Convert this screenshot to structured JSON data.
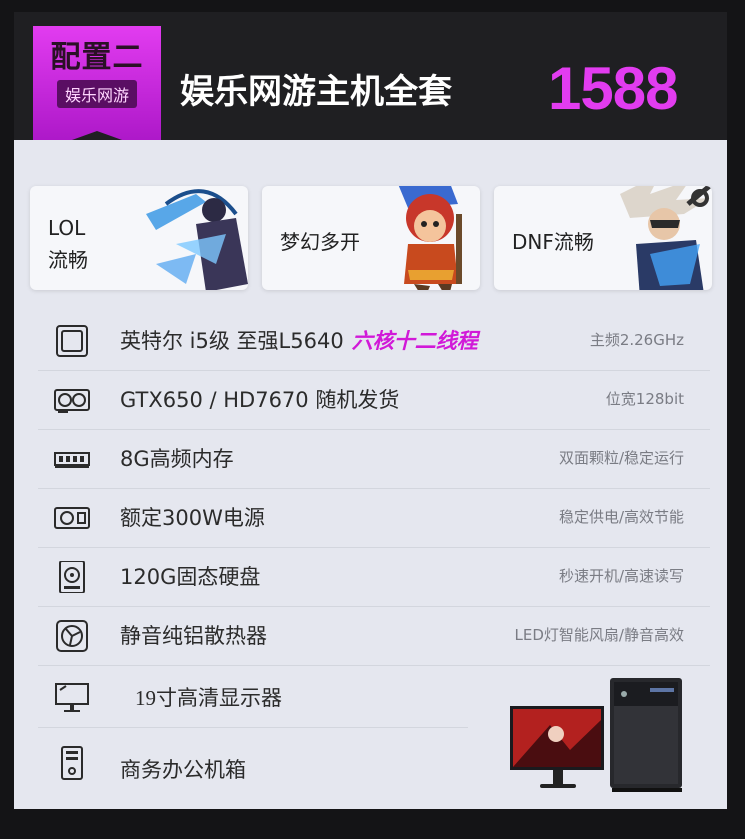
{
  "header": {
    "badge_main": "配置二",
    "badge_sub": "娱乐网游",
    "title": "娱乐网游主机全套",
    "price": "1588"
  },
  "cards": [
    {
      "label_line1": "LOL",
      "label_line2": "流畅",
      "icon": "archer-character-art"
    },
    {
      "label_line1": "梦幻多开",
      "label_line2": "",
      "icon": "cartoon-warrior-art"
    },
    {
      "label_line1": "DNF流畅",
      "label_line2": "",
      "icon": "swordsman-character-art"
    }
  ],
  "specs": [
    {
      "icon": "cpu-icon",
      "label": "英特尔 i5级 至强L5640",
      "highlight": "六核十二线程",
      "note": "主频2.26GHz"
    },
    {
      "icon": "gpu-icon",
      "label": "GTX650 / HD7670 随机发货",
      "highlight": "",
      "note": "位宽128bit"
    },
    {
      "icon": "ram-icon",
      "label": "8G高频内存",
      "highlight": "",
      "note": "双面颗粒/稳定运行"
    },
    {
      "icon": "psu-icon",
      "label": "额定300W电源",
      "highlight": "",
      "note": "稳定供电/高效节能"
    },
    {
      "icon": "ssd-icon",
      "label": "120G固态硬盘",
      "highlight": "",
      "note": "秒速开机/高速读写"
    },
    {
      "icon": "fan-icon",
      "label": "静音纯铝散热器",
      "highlight": "",
      "note": "LED灯智能风扇/静音高效"
    },
    {
      "icon": "monitor-icon",
      "label": "19寸高清显示器",
      "highlight": "",
      "note": ""
    },
    {
      "icon": "case-icon",
      "label": "商务办公机箱",
      "highlight": "",
      "note": ""
    }
  ],
  "colors": {
    "accent": "#e23cf0",
    "panel": "#e5e7ef",
    "dark": "#1f1f22"
  }
}
